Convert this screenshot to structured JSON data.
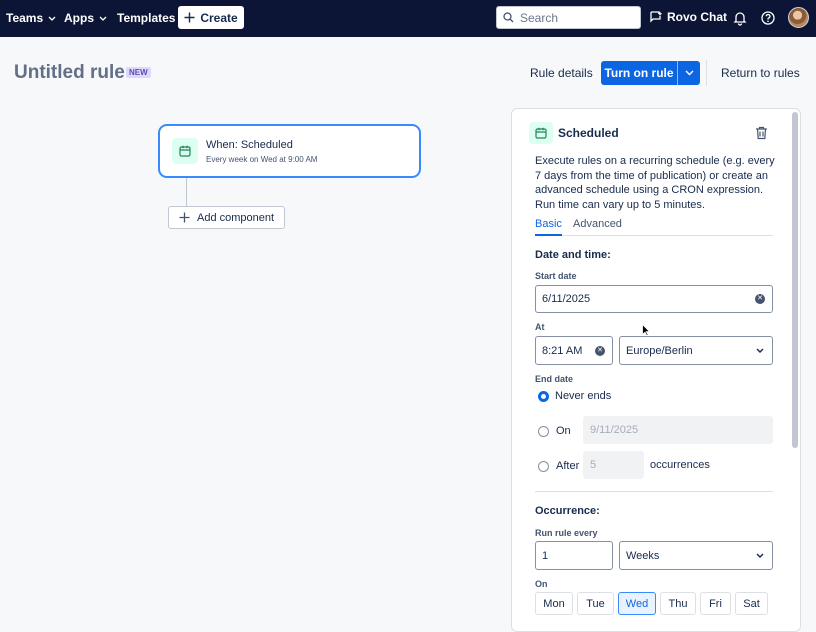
{
  "nav": {
    "teams": "Teams",
    "apps": "Apps",
    "templates": "Templates",
    "create": "Create",
    "search_placeholder": "Search",
    "rovo": "Rovo Chat",
    "icons": [
      "search-icon",
      "rovo-chat-icon",
      "bell-icon",
      "help-icon",
      "avatar"
    ]
  },
  "header": {
    "title": "Untitled rule",
    "badge": "NEW",
    "rule_details": "Rule details",
    "turn_on": "Turn on rule",
    "return": "Return to rules"
  },
  "canvas": {
    "trigger_title": "When: Scheduled",
    "trigger_sub": "Every week on Wed at 9:00 AM",
    "add_component": "Add component"
  },
  "panel": {
    "title": "Scheduled",
    "description": "Execute rules on a recurring schedule (e.g. every 7 days from the time of publication) or create an advanced schedule using a CRON expression. Run time can vary up to 5 minutes.",
    "tabs": [
      "Basic",
      "Advanced"
    ],
    "active_tab": "Basic",
    "date_time_heading": "Date and time:",
    "start_date_label": "Start date",
    "start_date": "6/11/2025",
    "at_label": "At",
    "time": "8:21 AM",
    "timezone": "Europe/Berlin",
    "end_date_label": "End date",
    "end_options": {
      "never": "Never ends",
      "on": "On",
      "on_date": "9/11/2025",
      "after": "After",
      "after_count": "5",
      "occurrences": "occurrences",
      "selected": "never"
    },
    "occurrence_heading": "Occurrence:",
    "run_every_label": "Run rule every",
    "run_every_value": "1",
    "run_every_unit": "Weeks",
    "on_label": "On",
    "days": [
      "Mon",
      "Tue",
      "Wed",
      "Thu",
      "Fri",
      "Sat"
    ],
    "selected_day": "Wed"
  },
  "colors": {
    "nav_bg": "#0c1535",
    "primary": "#0c66e4",
    "trigger_icon_bg": "#dcfff1",
    "badge_bg": "#dfd8fd"
  }
}
